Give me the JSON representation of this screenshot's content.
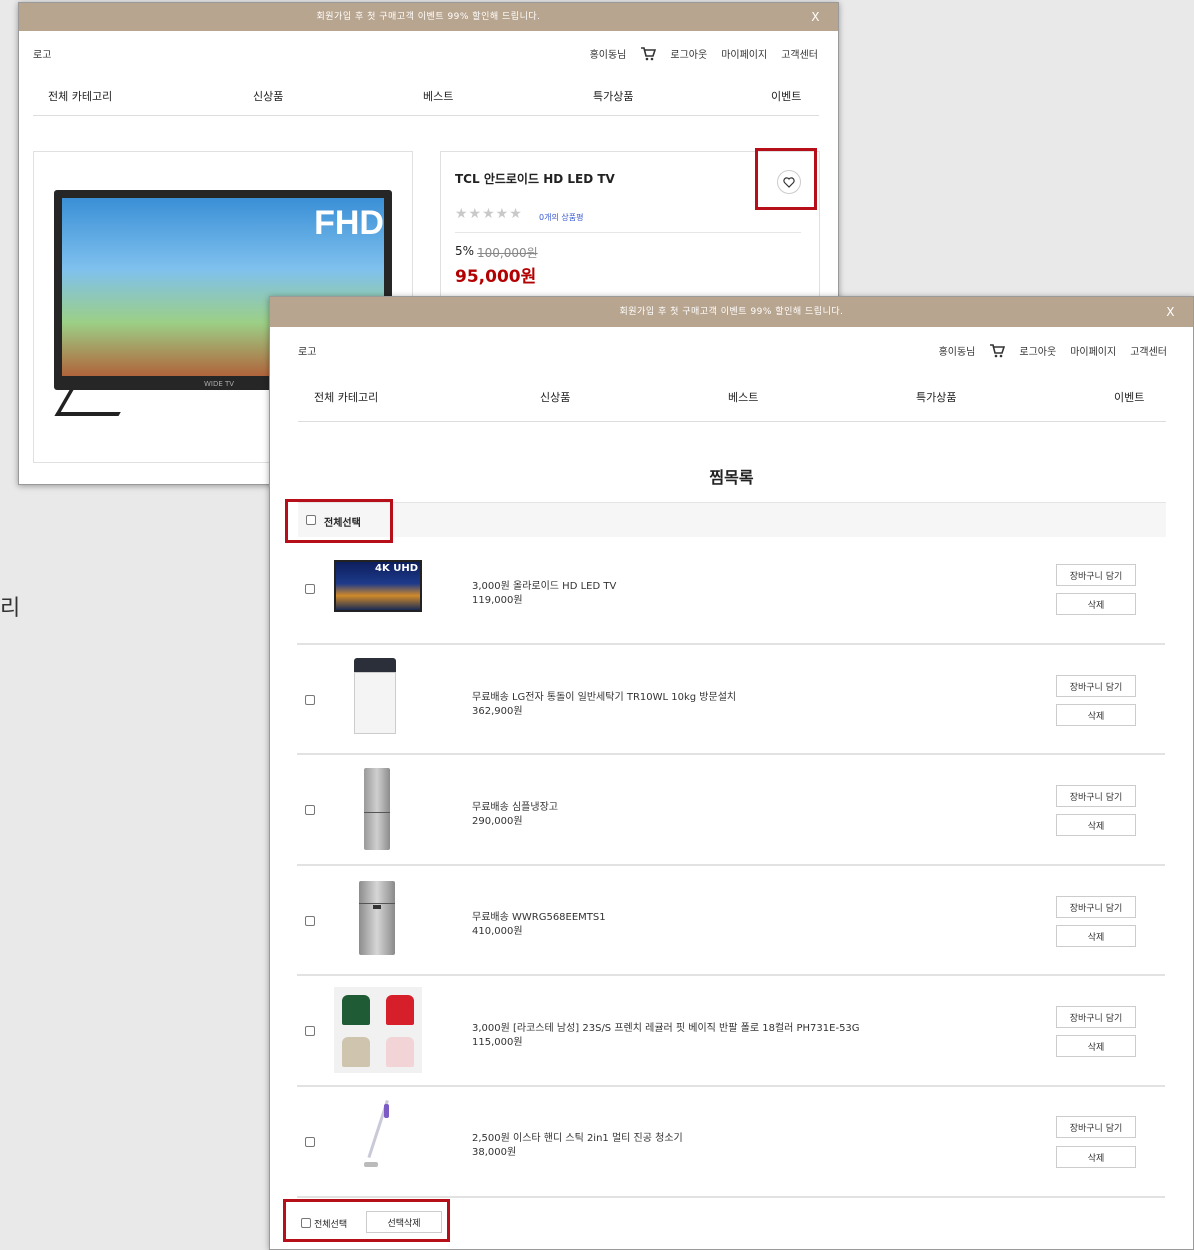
{
  "colors": {
    "banner": "#b8a58f",
    "highlight": "#b70f1a",
    "sale_price": "#b30000",
    "rating_link": "#3a5ad1"
  },
  "banner": {
    "text": "회원가입 후 첫 구매고객 이벤트 99% 할인해 드립니다.",
    "close": "X"
  },
  "header": {
    "logo": "로고",
    "user": "홍이동님",
    "logout": "로그아웃",
    "mypage": "마이페이지",
    "support": "고객센터"
  },
  "nav": [
    "전체 카테고리",
    "신상품",
    "베스트",
    "특가상품",
    "이벤트"
  ],
  "product": {
    "name": "TCL 안드로이드 HD LED TV",
    "stars": "★★★★★",
    "review_link": "0개의 상품평",
    "discount": "5%",
    "original_price": "100,000원",
    "price": "95,000원",
    "image_badge": "FHD",
    "image_caption": "WIDE TV"
  },
  "side_fragment": "리",
  "wishlist": {
    "title": "찜목록",
    "select_all": "전체선택",
    "add_to_cart": "장바구니 담기",
    "delete": "삭제",
    "delete_selected": "선택삭제",
    "items": [
      {
        "name": "3,000원 올라로이드 HD LED TV",
        "price": "119,000원",
        "thumb_icon": "tv-icon",
        "thumb_text": "4K UHD"
      },
      {
        "name": "무료배송 LG전자 통돌이 일반세탁기 TR10WL 10kg 방문설치",
        "price": "362,900원",
        "thumb_icon": "washer-icon"
      },
      {
        "name": "무료배송 심플냉장고",
        "price": "290,000원",
        "thumb_icon": "fridge-icon"
      },
      {
        "name": "무료배송 WWRG568EEMTS1",
        "price": "410,000원",
        "thumb_icon": "fridge-icon"
      },
      {
        "name": "3,000원 [라코스테 남성] 23S/S 프렌치 레귤러 핏 베이직 반팔 폴로 18컬러 PH731E-53G",
        "price": "115,000원",
        "thumb_icon": "polo-shirt-icon"
      },
      {
        "name": "2,500원 이스타 핸디 스틱 2in1 멀티 진공 청소기",
        "price": "38,000원",
        "thumb_icon": "vacuum-icon"
      }
    ]
  }
}
